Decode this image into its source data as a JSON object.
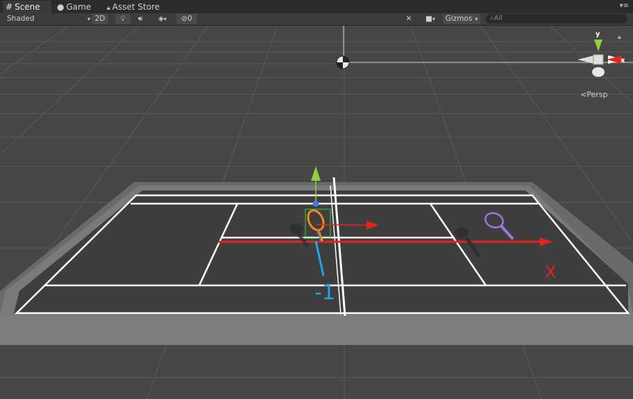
{
  "tabs": [
    {
      "label": "Scene",
      "icon": "scene-grid-icon",
      "active": true
    },
    {
      "label": "Game",
      "icon": "game-icon",
      "active": false
    },
    {
      "label": "Asset Store",
      "icon": "lock-icon",
      "active": false
    }
  ],
  "toolbar": {
    "shading_mode": "Shaded",
    "mode_2d": "2D",
    "hidden_count": "0",
    "gizmos_label": "Gizmos",
    "search_placeholder": "All"
  },
  "scene": {
    "view_mode": "Persp",
    "gizmo_axes": {
      "y": "y",
      "x": "x"
    },
    "annotations": {
      "x_label": "X",
      "minus_one": "-1"
    },
    "colors": {
      "background": "#464646",
      "court_fill": "#3e3e3e",
      "court_lines": "#ffffff",
      "x_axis": "#e8221b",
      "y_axis": "#8fd13a",
      "z_axis": "#3c7be8",
      "annotation_blue": "#22a3e6",
      "racket_purple": "#9b7ad6"
    }
  }
}
